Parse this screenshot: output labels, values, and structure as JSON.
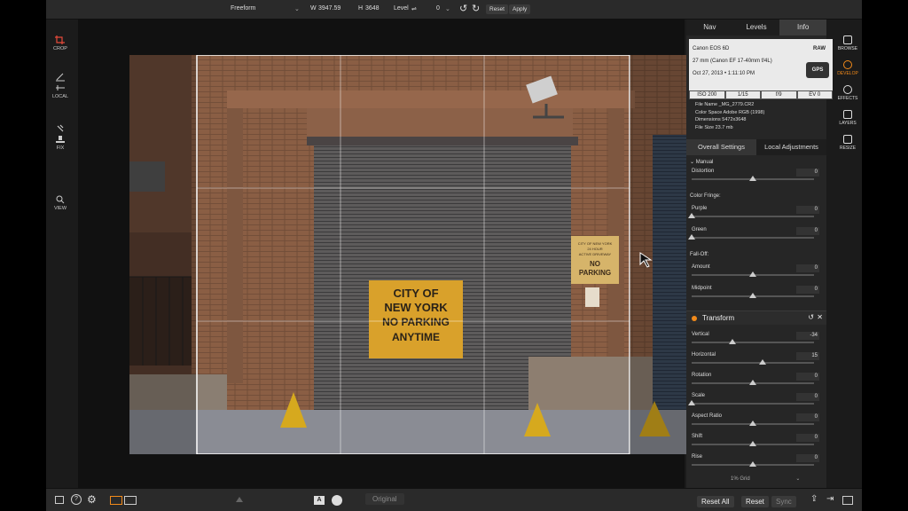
{
  "topbar": {
    "mode": "Freeform",
    "w_label": "W",
    "w_value": "3947.59",
    "h_label": "H",
    "h_value": "3648",
    "level_label": "Level",
    "level_value": "0",
    "reset": "Reset",
    "apply": "Apply"
  },
  "left_tools": [
    {
      "label": "CROP",
      "icon": "crop-icon"
    },
    {
      "label": "LOCAL",
      "icon": "local-icon"
    },
    {
      "label": "FIX",
      "icon": "fix-icon"
    },
    {
      "label": "VIEW",
      "icon": "view-icon"
    }
  ],
  "photo": {
    "sign_main": "CITY OF\nNEW YORK\nNO PARKING\nANYTIME",
    "sign_small_top": "CITY OF NEW YORK\n24 HOUR\nACTIVE DRIVEWAY",
    "sign_small_bottom": "NO\nPARKING"
  },
  "right_panel": {
    "tabs": [
      "Nav",
      "Levels",
      "Info"
    ],
    "active_tab": "Info",
    "camera": "Canon EOS 6D",
    "lens": "27 mm (Canon EF 17-40mm f/4L)",
    "date": "Oct 27, 2013 • 1:11:10 PM",
    "raw_badge": "RAW",
    "gps_badge": "GPS",
    "exposure": [
      "ISO 200",
      "1/15",
      "f/9",
      "EV 0"
    ],
    "file_name_label": "File Name",
    "file_name": "_MG_2779.CR2",
    "color_space_label": "Color Space",
    "color_space": "Adobe RGB (1998)",
    "dimensions_label": "Dimensions",
    "dimensions": "5472x3648",
    "file_size_label": "File Size",
    "file_size": "23.7 mb",
    "settings_tabs": [
      "Overall Settings",
      "Local Adjustments"
    ],
    "active_settings_tab": "Overall Settings",
    "manual_label": "Manual",
    "color_fringe_label": "Color Fringe:",
    "falloff_label": "Fall-Off:",
    "lens_rows": [
      {
        "label": "Distortion",
        "value": "0",
        "knob": 0.5
      },
      {
        "label": "Purple",
        "value": "0",
        "knob": 0.0
      },
      {
        "label": "Green",
        "value": "0",
        "knob": 0.0
      },
      {
        "label": "Amount",
        "value": "0",
        "knob": 0.5
      },
      {
        "label": "Midpoint",
        "value": "0",
        "knob": 0.5
      }
    ],
    "transform_title": "Transform",
    "transform_rows": [
      {
        "label": "Vertical",
        "value": "-34",
        "knob": 0.33
      },
      {
        "label": "Horizontal",
        "value": "15",
        "knob": 0.58
      },
      {
        "label": "Rotation",
        "value": "0",
        "knob": 0.5
      },
      {
        "label": "Scale",
        "value": "0",
        "knob": 0.0
      },
      {
        "label": "Aspect Ratio",
        "value": "0",
        "knob": 0.5
      },
      {
        "label": "Shift",
        "value": "0",
        "knob": 0.5
      },
      {
        "label": "Rise",
        "value": "0",
        "knob": 0.5
      }
    ],
    "grid_label": "1% Grid"
  },
  "far_right_tools": [
    {
      "label": "BROWSE",
      "icon": "browse-icon"
    },
    {
      "label": "DEVELOP",
      "icon": "develop-icon",
      "active": true
    },
    {
      "label": "EFFECTS",
      "icon": "effects-icon"
    },
    {
      "label": "LAYERS",
      "icon": "layers-icon"
    },
    {
      "label": "RESIZE",
      "icon": "resize-icon"
    }
  ],
  "bottombar": {
    "original": "Original",
    "reset_all": "Reset All",
    "reset": "Reset",
    "sync": "Sync"
  },
  "colors": {
    "accent": "#f28a1a",
    "panel": "#262626"
  }
}
